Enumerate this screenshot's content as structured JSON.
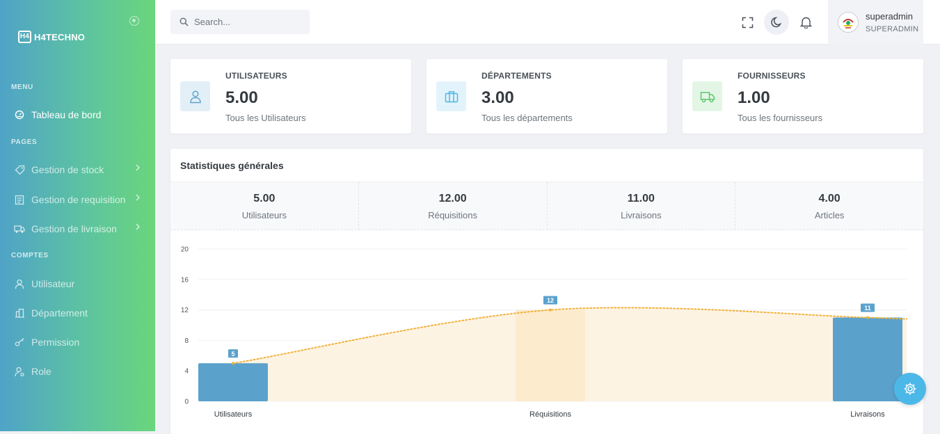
{
  "sidebar": {
    "brand": "H4TECHNO",
    "brand_logo": "H4",
    "sections": {
      "menu": "MENU",
      "pages": "PAGES",
      "comptes": "COMPTES"
    },
    "items": {
      "dashboard": "Tableau de bord",
      "stock": "Gestion de stock",
      "requisition": "Gestion de requisition",
      "livraison": "Gestion de livraison",
      "utilisateur": "Utilisateur",
      "departement": "Département",
      "permission": "Permission",
      "role": "Role"
    }
  },
  "topbar": {
    "search_placeholder": "Search...",
    "user_name": "superadmin",
    "user_role": "SUPERADMIN"
  },
  "cards": [
    {
      "label": "UTILISATEURS",
      "value": "5.00",
      "sub": "Tous les Utilisateurs",
      "icon": "user-icon",
      "color": "#5ea4cf"
    },
    {
      "label": "DÉPARTEMENTS",
      "value": "3.00",
      "sub": "Tous les départements",
      "icon": "briefcase-icon",
      "color": "#4fb6e0"
    },
    {
      "label": "FOURNISSEURS",
      "value": "1.00",
      "sub": "Tous les fournisseurs",
      "icon": "truck-icon",
      "color": "#5cc46a"
    }
  ],
  "stats": {
    "title": "Statistiques générales",
    "kpis": [
      {
        "value": "5.00",
        "label": "Utilisateurs"
      },
      {
        "value": "12.00",
        "label": "Réquisitions"
      },
      {
        "value": "11.00",
        "label": "Livraisons"
      },
      {
        "value": "4.00",
        "label": "Articles"
      }
    ]
  },
  "chart_data": {
    "type": "bar",
    "categories": [
      "Utilisateurs",
      "Réquisitions",
      "Livraisons"
    ],
    "values": [
      5,
      12,
      11
    ],
    "data_labels": [
      "5",
      "12",
      "11"
    ],
    "ylim": [
      0,
      20
    ],
    "yticks": [
      0,
      4,
      8,
      12,
      16,
      20
    ],
    "bar_color": "#5aa2cc",
    "line_color": "#f0b13a",
    "area_color": "#fdf3e3",
    "grid": true
  }
}
